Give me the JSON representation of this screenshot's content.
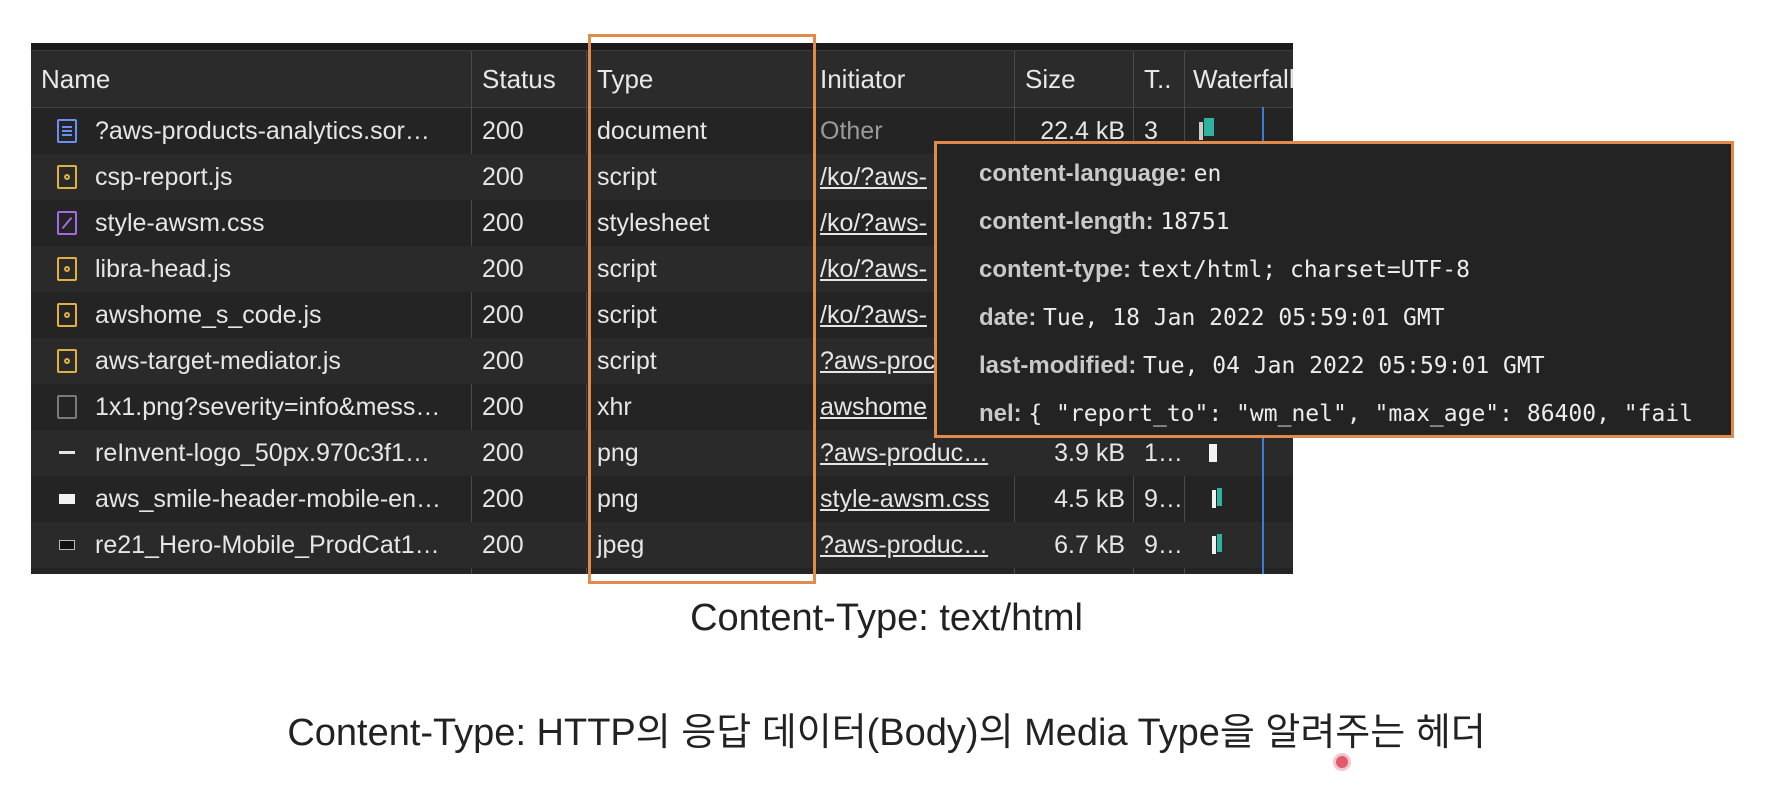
{
  "columns": {
    "name": "Name",
    "status": "Status",
    "type": "Type",
    "initiator": "Initiator",
    "size": "Size",
    "time": "T..",
    "waterfall": "Waterfall"
  },
  "rows": [
    {
      "icon": "document-icon",
      "name": "?aws-products-analytics.sor…",
      "status": "200",
      "type": "document",
      "initiator": "Other",
      "size": "22.4 kB",
      "time": "3"
    },
    {
      "icon": "script-icon",
      "name": "csp-report.js",
      "status": "200",
      "type": "script",
      "initiator": "/ko/?aws-",
      "size": "",
      "time": ""
    },
    {
      "icon": "stylesheet-icon",
      "name": "style-awsm.css",
      "status": "200",
      "type": "stylesheet",
      "initiator": "/ko/?aws-",
      "size": "",
      "time": ""
    },
    {
      "icon": "script-icon",
      "name": "libra-head.js",
      "status": "200",
      "type": "script",
      "initiator": "/ko/?aws-",
      "size": "",
      "time": ""
    },
    {
      "icon": "script-icon",
      "name": "awshome_s_code.js",
      "status": "200",
      "type": "script",
      "initiator": "/ko/?aws-",
      "size": "",
      "time": ""
    },
    {
      "icon": "script-icon",
      "name": "aws-target-mediator.js",
      "status": "200",
      "type": "script",
      "initiator": "?aws-proc",
      "size": "",
      "time": ""
    },
    {
      "icon": "xhr-icon",
      "name": "1x1.png?severity=info&mess…",
      "status": "200",
      "type": "xhr",
      "initiator": "awshome",
      "size": "",
      "time": ""
    },
    {
      "icon": "image-icon",
      "name": "reInvent-logo_50px.970c3f1…",
      "status": "200",
      "type": "png",
      "initiator": "?aws-produc…",
      "size": "3.9 kB",
      "time": "1…"
    },
    {
      "icon": "image-icon",
      "name": "aws_smile-header-mobile-en…",
      "status": "200",
      "type": "png",
      "initiator": "style-awsm.css",
      "size": "4.5 kB",
      "time": "9…"
    },
    {
      "icon": "image-icon",
      "name": "re21_Hero-Mobile_ProdCat1…",
      "status": "200",
      "type": "jpeg",
      "initiator": "?aws-produc…",
      "size": "6.7 kB",
      "time": "9…"
    }
  ],
  "tooltip": {
    "headers": [
      {
        "key": "content-language:",
        "value": "en"
      },
      {
        "key": "content-length:",
        "value": "18751"
      },
      {
        "key": "content-type:",
        "value": "text/html; charset=UTF-8"
      },
      {
        "key": "date:",
        "value": "Tue, 18 Jan 2022 05:59:01 GMT"
      },
      {
        "key": "last-modified:",
        "value": "Tue, 04 Jan 2022 05:59:01 GMT"
      },
      {
        "key": "nel:",
        "value": "{ \"report_to\": \"wm_nel\", \"max_age\": 86400, \"fail"
      }
    ]
  },
  "captions": {
    "line1": "Content-Type: text/html",
    "line2": "Content-Type: HTTP의 응답 데이터(Body)의 Media Type을 알려주는 헤더"
  },
  "colors": {
    "highlight": "#e08a4c",
    "panel_bg": "#242424",
    "waterfall_blue": "#3b7dd8"
  }
}
